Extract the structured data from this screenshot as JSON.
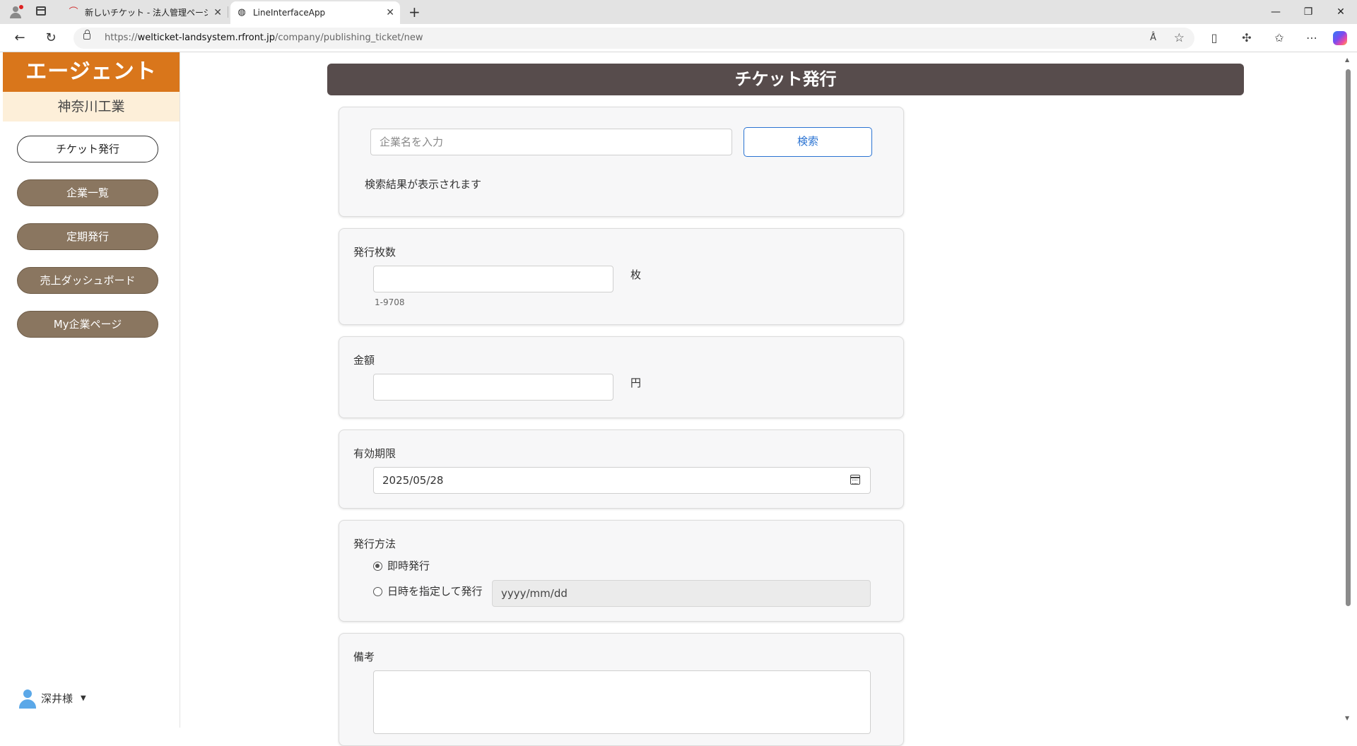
{
  "browser": {
    "tabs": [
      {
        "title": "新しいチケット - 法人管理ページ開発",
        "icon": "red-brand-icon"
      },
      {
        "title": "LineInterfaceApp",
        "icon": "globe-icon"
      }
    ],
    "url_prefix": "https://",
    "url_host": "welticket-landsystem.rfront.jp",
    "url_path": "/company/publishing_ticket/new",
    "read_aloud": "Â̇"
  },
  "sidebar": {
    "brand": "エージェント",
    "company": "神奈川工業",
    "items": [
      {
        "label": "チケット発行",
        "active": true
      },
      {
        "label": "企業一覧",
        "active": false
      },
      {
        "label": "定期発行",
        "active": false
      },
      {
        "label": "売上ダッシュボード",
        "active": false
      },
      {
        "label": "My企業ページ",
        "active": false
      }
    ],
    "user_name": "深井様"
  },
  "main": {
    "title": "チケット発行",
    "search": {
      "placeholder": "企業名を入力",
      "button": "検索",
      "result_text": "検索結果が表示されます"
    },
    "quantity": {
      "label": "発行枚数",
      "unit": "枚",
      "range_hint": "1-9708",
      "value": ""
    },
    "amount": {
      "label": "金額",
      "unit": "円",
      "value": ""
    },
    "expiry": {
      "label": "有効期限",
      "value": "2025/05/28"
    },
    "method": {
      "label": "発行方法",
      "options": [
        {
          "label": "即時発行",
          "selected": true
        },
        {
          "label": "日時を指定して発行",
          "selected": false
        }
      ],
      "schedule_placeholder": "yyyy/mm/dd"
    },
    "remarks": {
      "label": "備考",
      "value": ""
    }
  },
  "colors": {
    "brand": "#d9761b",
    "company_bg": "#fdefd9",
    "nav_button": "#8a7660",
    "header_bg": "#574c4c",
    "search_button": "#2a73d2"
  }
}
